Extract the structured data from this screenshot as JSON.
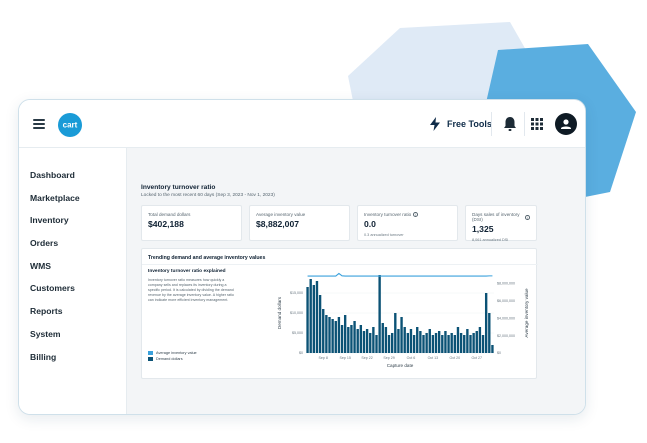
{
  "colors": {
    "accent": "#1a9bd7",
    "bar": "#0b5275",
    "line": "#3aa1dc",
    "bg_shape_light": "#dfeaf6",
    "bg_shape_blue": "#5aaee0",
    "nav_bolt": "#0f2c49"
  },
  "header": {
    "logo_text": "cart",
    "free_tools_label": "Free Tools",
    "icons": [
      "hamburger-icon",
      "bolt-icon",
      "bell-icon",
      "apps-grid-icon",
      "user-icon"
    ]
  },
  "sidebar": {
    "items": [
      {
        "label": "Dashboard"
      },
      {
        "label": "Marketplace"
      },
      {
        "label": "Inventory"
      },
      {
        "label": "Orders"
      },
      {
        "label": "WMS"
      },
      {
        "label": "Customers"
      },
      {
        "label": "Reports"
      },
      {
        "label": "System"
      },
      {
        "label": "Billing"
      }
    ]
  },
  "page": {
    "title": "Inventory turnover ratio",
    "subtitle": "Locked to the most recent 60 days  (Sep 3, 2023 - Nov 1, 2023)"
  },
  "kpis": [
    {
      "label": "Total demand dollars",
      "value": "$402,188",
      "note": "",
      "info": false
    },
    {
      "label": "Average inventory value",
      "value": "$8,882,007",
      "note": "",
      "info": false
    },
    {
      "label": "Inventory turnover ratio",
      "value": "0.0",
      "note": "0.3 annualized turnover",
      "info": true
    },
    {
      "label": "Days sales of inventory (DSI)",
      "value": "1,325",
      "note": "8,061 annualized DSI",
      "info": true
    }
  ],
  "chart_section": {
    "heading": "Trending demand and average inventory values",
    "explain_title": "Inventory turnover ratio explained",
    "explain_text": "Inventory turnover ratio measures how quickly a company sells and replaces its inventory during a specific period. It is calculated by dividing the demand revenue by the average inventory value. A higher ratio can indicate more efficient inventory management.",
    "legend": [
      {
        "name": "Average inventory value"
      },
      {
        "name": "Demand dollars"
      }
    ]
  },
  "chart_data": {
    "type": "bar",
    "xlabel": "Capture date",
    "ylabel": "Demand dollars",
    "y2label": "Average inventory value",
    "x_ticks": [
      "Sep 8",
      "Sep 15",
      "Sep 22",
      "Sep 29",
      "Oct 6",
      "Oct 13",
      "Oct 20",
      "Oct 27"
    ],
    "y_ticks": [
      "$0",
      "$5,000",
      "$10,000",
      "$15,000"
    ],
    "y2_ticks": [
      "$0",
      "$2,000,000",
      "$4,000,000",
      "$6,000,000",
      "$8,000,000"
    ],
    "ylim": [
      0,
      20000
    ],
    "y2lim": [
      0,
      9200000
    ],
    "series": [
      {
        "name": "Demand dollars",
        "type": "bar",
        "values": [
          16500,
          18500,
          17000,
          18000,
          14500,
          11000,
          9500,
          9000,
          8500,
          8000,
          9000,
          7000,
          9500,
          6500,
          7000,
          8000,
          6000,
          7000,
          5500,
          6000,
          5000,
          6500,
          4500,
          19500,
          7500,
          6500,
          4500,
          5000,
          10000,
          6000,
          9000,
          6500,
          5000,
          6000,
          4500,
          6500,
          5500,
          4500,
          5000,
          6000,
          4500,
          5000,
          5500,
          4500,
          5500,
          4500,
          5000,
          4500,
          6500,
          5000,
          4500,
          6000,
          4500,
          5000,
          5500,
          6500,
          4500,
          15000,
          10000,
          2000
        ]
      },
      {
        "name": "Average inventory value",
        "type": "line",
        "values": [
          8850000,
          8850000,
          8850000,
          8850000,
          8850000,
          8850000,
          8850000,
          8850000,
          8850000,
          8850000,
          9150000,
          8880000,
          8850000,
          8850000,
          8850000,
          8850000,
          8850000,
          8850000,
          8850000,
          8850000,
          8850000,
          8850000,
          8850000,
          8850000,
          8850000,
          8850000,
          8850000,
          8850000,
          8850000,
          8850000,
          8850000,
          8850000,
          8850000,
          8850000,
          8850000,
          8850000,
          8850000,
          8850000,
          8850000,
          8850000,
          8850000,
          8850000,
          8850000,
          8850000,
          8850000,
          8850000,
          8850000,
          8850000,
          8850000,
          8850000,
          8850000,
          8850000,
          8850000,
          8850000,
          8850000,
          8850000,
          8850000,
          8850000,
          8870000,
          8870000
        ]
      }
    ]
  }
}
